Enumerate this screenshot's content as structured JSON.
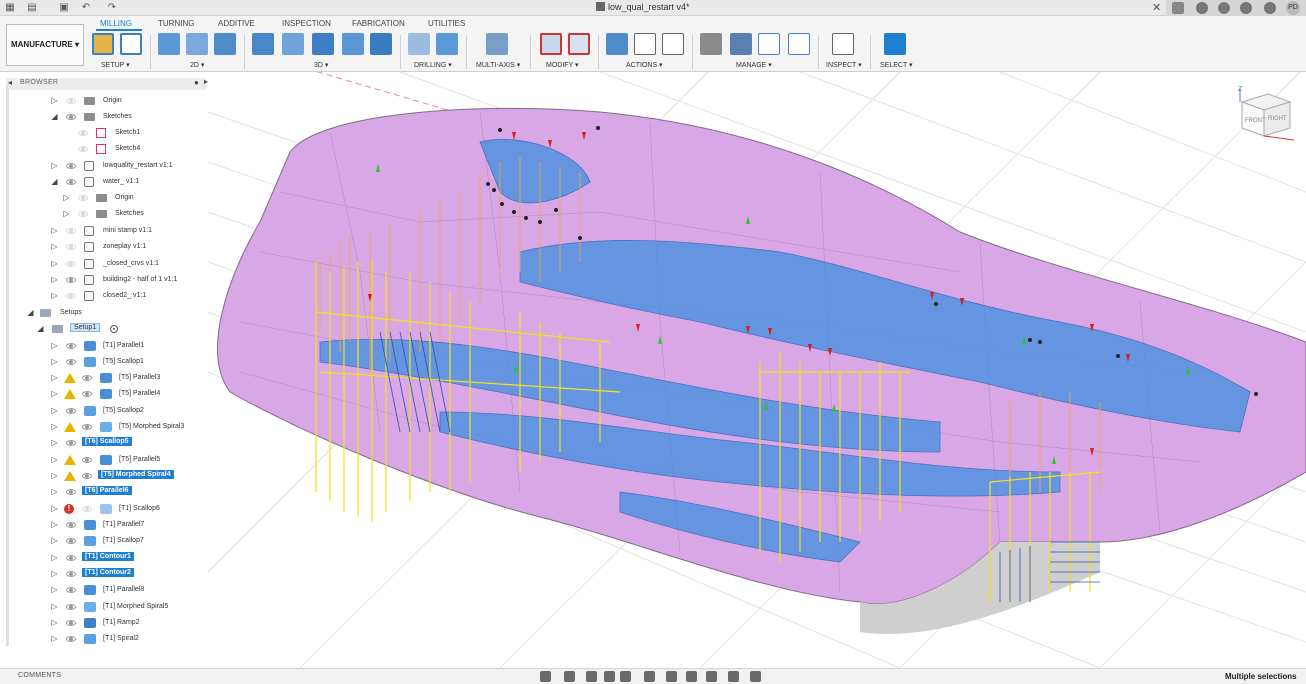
{
  "window": {
    "document_title": "low_qual_restart v4*",
    "user_initials": "PD"
  },
  "ribbon": {
    "workspace": "MANUFACTURE ▾",
    "tabs": [
      {
        "label": "MILLING",
        "active": true
      },
      {
        "label": "TURNING",
        "active": false
      },
      {
        "label": "ADDITIVE",
        "active": false
      },
      {
        "label": "INSPECTION",
        "active": false
      },
      {
        "label": "FABRICATION",
        "active": false
      },
      {
        "label": "UTILITIES",
        "active": false
      }
    ],
    "groups": [
      {
        "label": "SETUP ▾"
      },
      {
        "label": "2D ▾"
      },
      {
        "label": "3D ▾"
      },
      {
        "label": "DRILLING ▾"
      },
      {
        "label": "MULTI-AXIS ▾"
      },
      {
        "label": "MODIFY ▾"
      },
      {
        "label": "ACTIONS ▾"
      },
      {
        "label": "MANAGE ▾"
      },
      {
        "label": "INSPECT ▾"
      },
      {
        "label": "SELECT ▾"
      }
    ],
    "accent_color": "#1f7fd0"
  },
  "browser": {
    "header": "BROWSER",
    "items": [
      {
        "label": "Origin"
      },
      {
        "label": "Sketches"
      },
      {
        "label": "Sketch1"
      },
      {
        "label": "Sketch4"
      },
      {
        "label": "lowquality_restart v1:1"
      },
      {
        "label": "water_ v1:1"
      },
      {
        "label": "Origin"
      },
      {
        "label": "Sketches"
      },
      {
        "label": "mini stamp v1:1"
      },
      {
        "label": "zoneplay v1:1"
      },
      {
        "label": "_closed_crvs v1:1"
      },
      {
        "label": "building2 - half of 1 v1:1"
      },
      {
        "label": "closed2_ v1:1"
      },
      {
        "label": "Setups"
      },
      {
        "label": "Setup1"
      },
      {
        "label": "[T1] Parallel1"
      },
      {
        "label": "[T5] Scallop1"
      },
      {
        "label": "[T5] Parallel3"
      },
      {
        "label": "[T5] Parallel4"
      },
      {
        "label": "[T5] Scallop2"
      },
      {
        "label": "[T5] Morphed Spiral3"
      },
      {
        "label": "[T6] Scallop5"
      },
      {
        "label": "[T5] Parallel5"
      },
      {
        "label": "[T5] Morphed Spiral4"
      },
      {
        "label": "[T6] Parallel6"
      },
      {
        "label": "[T1] Scallop6"
      },
      {
        "label": "[T1] Parallel7"
      },
      {
        "label": "[T1] Scallop7"
      },
      {
        "label": "[T1] Contour1"
      },
      {
        "label": "[T1] Contour2"
      },
      {
        "label": "[T1] Parallel8"
      },
      {
        "label": "[T1] Morphed Spiral5"
      },
      {
        "label": "[T1] Ramp2"
      },
      {
        "label": "[T1] Spiral2"
      }
    ]
  },
  "viewcube": {
    "axis_label": "Z",
    "faces": [
      "FRONT",
      "RIGHT"
    ]
  },
  "bottom": {
    "comments": "COMMENTS",
    "status": "Multiple selections"
  }
}
